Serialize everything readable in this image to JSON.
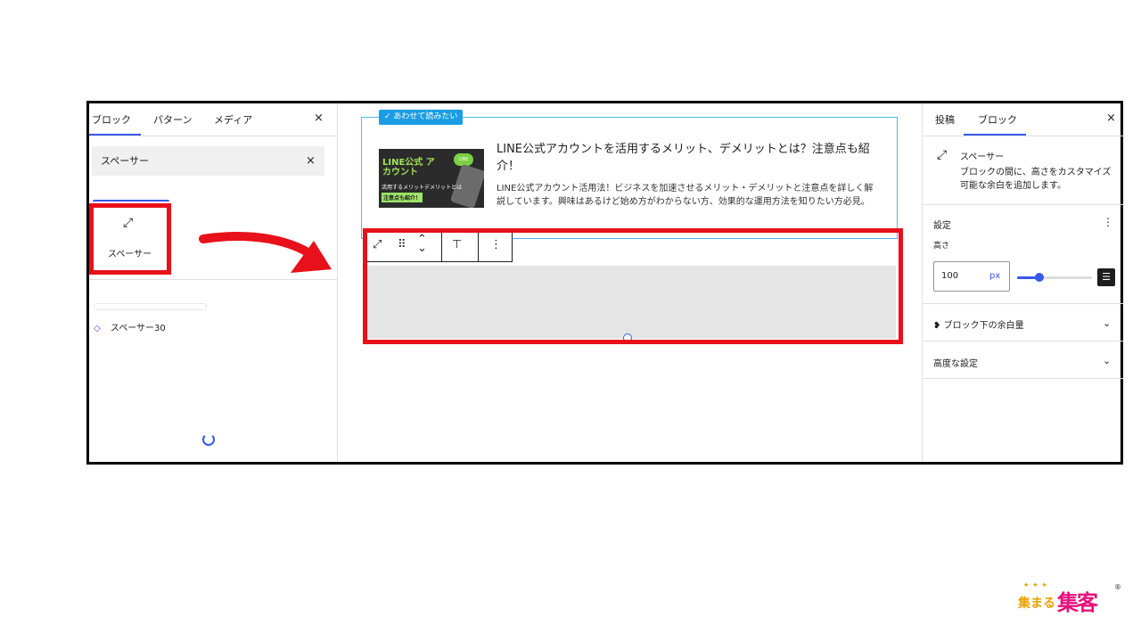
{
  "left_panel": {
    "tabs": [
      "ブロック",
      "パターン",
      "メディア"
    ],
    "close": "×",
    "search_value": "スペーサー",
    "search_clear": "×",
    "block_label": "スペーサー",
    "block_icon": "↗↙",
    "pattern_item": "スペーサー30"
  },
  "editor": {
    "badge": "✓ あわせて読みたい",
    "card_title": "LINE公式アカウントを活用するメリット、デメリットとは？注意点も紹介！",
    "card_desc": "LINE公式アカウント活用法！ビジネスを加速させるメリット・デメリットと注意点を詳しく解説しています。興味はあるけど始め方がわからない方、効果的な運用方法を知りたい方必見。",
    "thumb_title": "LINE公式 アカウント",
    "thumb_line": "LINE",
    "thumb_sub": "活用するメリットデメリットとは",
    "thumb_tag": "注意点も紹介！",
    "toolbar": {
      "resize": "⤢",
      "drag": "⠿",
      "up": "⌃",
      "down": "⌄",
      "align": "⊤",
      "more": "⋮"
    }
  },
  "right_panel": {
    "tabs": [
      "投稿",
      "ブロック"
    ],
    "close": "×",
    "block_name": "スペーサー",
    "block_desc": "ブロックの間に、高さをカスタマイズ可能な余白を追加します。",
    "settings_label": "設定",
    "height_label": "高さ",
    "height_value": "100",
    "height_unit": "px",
    "height_slider_fraction": 0.3,
    "section_margin": "ブロック下の余白量",
    "section_advanced": "高度な設定"
  },
  "logo": {
    "stars": "★★★",
    "text_a": "集まる",
    "text_b": "集客",
    "mark": "®"
  },
  "colors": {
    "highlight": "#e8101a",
    "accent": "#3858e9",
    "card_border": "#57b7e8",
    "badge": "#1a9de4"
  }
}
